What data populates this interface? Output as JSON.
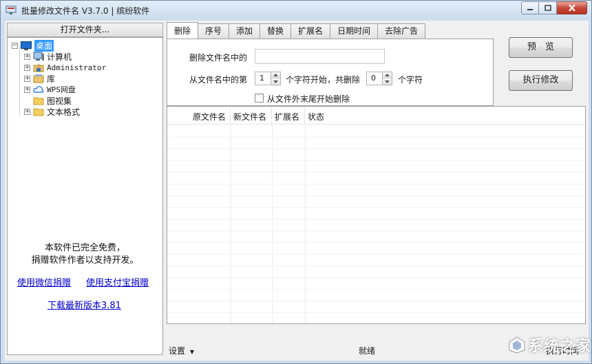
{
  "window": {
    "title": "批量修改文件名 V3.7.0 | 缤纷软件"
  },
  "left_panel": {
    "open_folder_label": "打开文件夹...",
    "tree": [
      {
        "label": "桌面",
        "icon": "desktop-icon",
        "selected": true
      },
      {
        "label": "计算机",
        "icon": "computer-icon"
      },
      {
        "label": "Administrator",
        "icon": "user-folder-icon"
      },
      {
        "label": "库",
        "icon": "library-icon"
      },
      {
        "label": "WPS网盘",
        "icon": "cloud-drive-icon"
      },
      {
        "label": "图视集",
        "icon": "folder-icon"
      },
      {
        "label": "文本格式",
        "icon": "folder-icon"
      }
    ],
    "donate_line1": "本软件已完全免费，",
    "donate_line2": "捐赠软件作者以支持开发。",
    "link_wechat": "使用微信捐赠",
    "link_alipay": "使用支付宝捐赠",
    "link_download": "下载最新版本3.81"
  },
  "tabs": [
    "删除",
    "序号",
    "添加",
    "替换",
    "扩展名",
    "日期时间",
    "去除广告"
  ],
  "delete_tab": {
    "delete_label": "删除文件名中的",
    "delete_value": "",
    "from_label": "从文件名中的第",
    "start_value": "1",
    "mid_label": "个字符开始，共删除",
    "count_value": "0",
    "unit_label": "个字符",
    "reverse_label": "从文件外末尾开始删除",
    "reverse_checked": false
  },
  "buttons": {
    "preview": "预　览",
    "execute": "执行修改"
  },
  "table": {
    "columns": [
      "原文件名",
      "新文件名",
      "扩展名",
      "状态"
    ],
    "rows": []
  },
  "statusbar": {
    "settings": "设置",
    "status": "就绪",
    "exec_time": "执行时间"
  },
  "watermark": {
    "text": "系统之家"
  }
}
